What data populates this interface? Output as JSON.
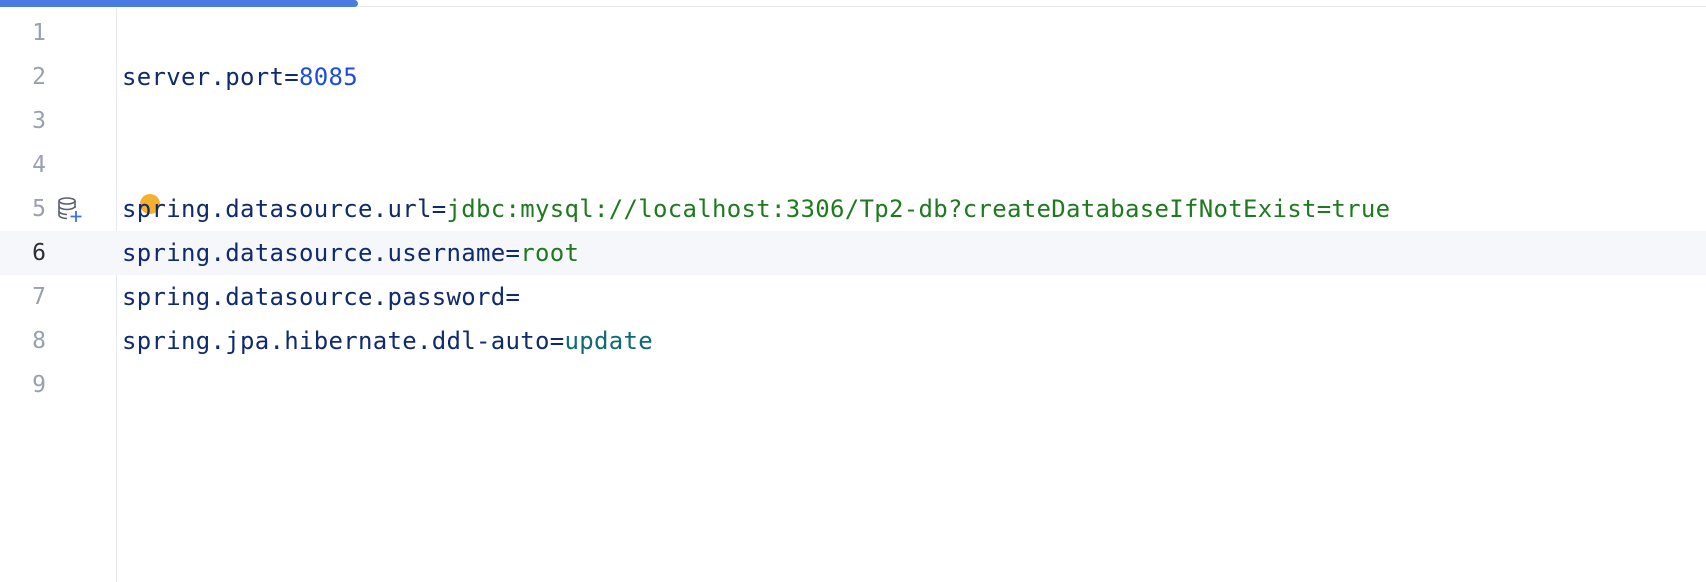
{
  "progress": {
    "fraction": 0.21,
    "color": "#4a7be0"
  },
  "lines": [
    {
      "number": "1",
      "key": "",
      "eq": "",
      "value": "",
      "value_type": ""
    },
    {
      "number": "2",
      "key": "server.port",
      "eq": "=",
      "value": "8085",
      "value_type": "num"
    },
    {
      "number": "3",
      "key": "",
      "eq": "",
      "value": "",
      "value_type": ""
    },
    {
      "number": "4",
      "key": "",
      "eq": "",
      "value": "",
      "value_type": ""
    },
    {
      "number": "5",
      "key": "spring.datasource.url",
      "eq": "=",
      "value": "jdbc:mysql://localhost:3306/Tp2-db?createDatabaseIfNotExist=true",
      "value_type": "str",
      "gutter_icon": "database-add-icon",
      "intention_bulb": "intention-bulb-icon"
    },
    {
      "number": "6",
      "key": "spring.datasource.username",
      "eq": "=",
      "value": "root",
      "value_type": "str",
      "current": true
    },
    {
      "number": "7",
      "key": "spring.datasource.password",
      "eq": "=",
      "value": "",
      "value_type": ""
    },
    {
      "number": "8",
      "key": "spring.jpa.hibernate.ddl-auto",
      "eq": "=",
      "value": "update",
      "value_type": "kw"
    },
    {
      "number": "9",
      "key": "",
      "eq": "",
      "value": "",
      "value_type": ""
    }
  ],
  "colors": {
    "key": "#0f2a6e",
    "number_value": "#1d4ed8",
    "string_value": "#1f7a1f",
    "keyword_value": "#0e6b73",
    "current_line_bg": "#f5f7fb",
    "bulb": "#f4b02e"
  }
}
